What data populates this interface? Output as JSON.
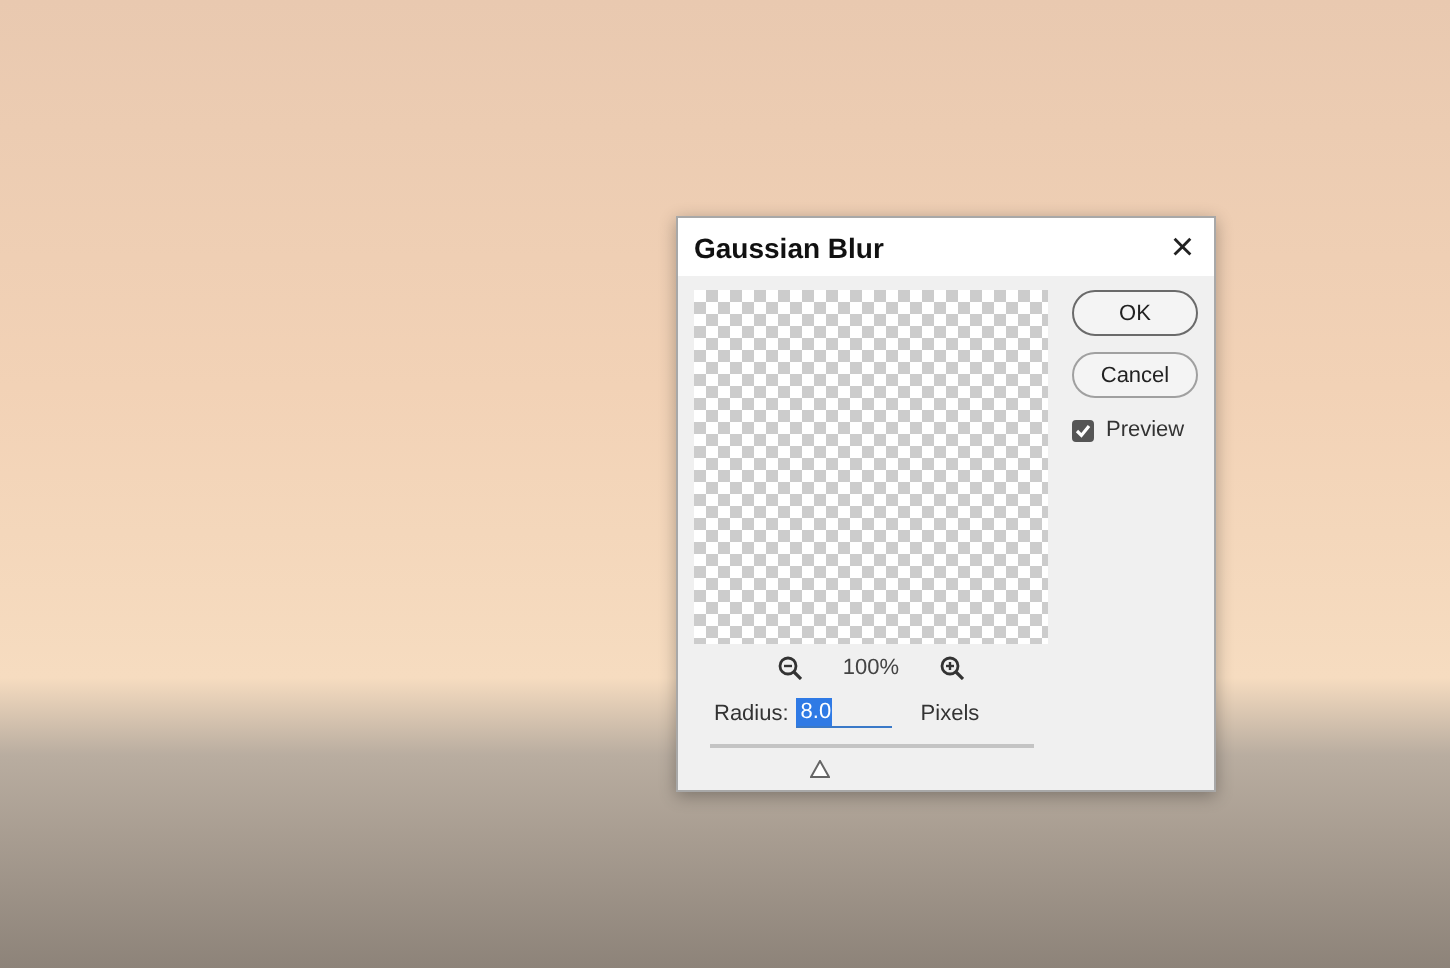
{
  "dialog": {
    "title": "Gaussian Blur",
    "close": "×",
    "buttons": [
      {
        "label": "OK",
        "default": true
      },
      {
        "label": "Cancel",
        "default": false
      }
    ],
    "preview": {
      "label": "Preview",
      "checked": true
    },
    "zoom": "100%",
    "radius": {
      "label": "Radius:",
      "value": "8.0",
      "unit": "Pixels",
      "selected": true
    },
    "slider": {
      "level": 0.34
    }
  }
}
